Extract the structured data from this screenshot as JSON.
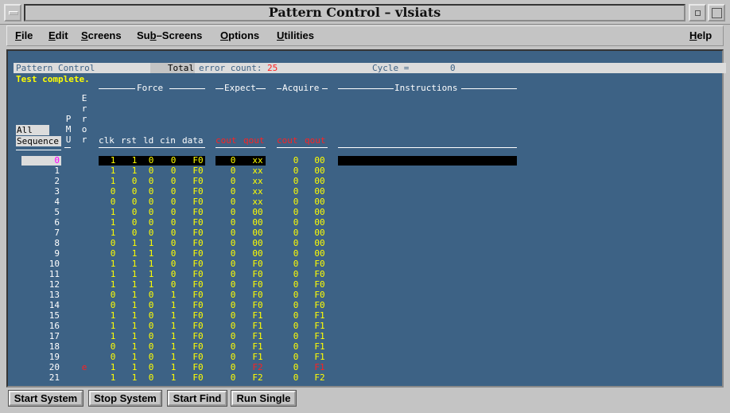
{
  "window": {
    "title": "Pattern Control – vlsiats"
  },
  "menu": {
    "items": [
      {
        "label": "File",
        "u": "F",
        "rest": "ile"
      },
      {
        "label": "Edit",
        "u": "E",
        "rest": "dit"
      },
      {
        "label": "Screens",
        "u": "S",
        "rest": "creens"
      },
      {
        "label": "Sub–Screens",
        "pre": "Su",
        "u": "b",
        "rest": "–Screens"
      },
      {
        "label": "Options",
        "u": "O",
        "rest": "ptions"
      },
      {
        "label": "Utilities",
        "u": "U",
        "rest": "tilities"
      }
    ],
    "help": {
      "u": "H",
      "rest": "elp"
    }
  },
  "info": {
    "panel_label": "Pattern Control",
    "total_label": "Total",
    "error_label": "error count:",
    "error_count": "25",
    "cycle_label": "Cycle =",
    "cycle_value": "0",
    "status": "Test complete."
  },
  "headers": {
    "force": "Force",
    "expect": "Expect",
    "acquire": "Acquire",
    "instructions": "Instructions",
    "pmu": [
      "P",
      "M",
      "U"
    ],
    "error": [
      "E",
      "r",
      "r",
      "o",
      "r"
    ],
    "all_button": "All",
    "sequence_button": "Sequence",
    "force_cols": [
      "clk",
      "rst",
      "ld",
      "cin",
      "data"
    ],
    "expect_cols": [
      "cout",
      "qout"
    ],
    "acquire_cols": [
      "cout",
      "qout"
    ]
  },
  "colors": {
    "panel": "#3d6285",
    "yellow": "#ffff00",
    "red": "#ff2020",
    "white": "#ffffff"
  },
  "rows": [
    {
      "n": "0",
      "err": "",
      "clk": "1",
      "rst": "1",
      "ld": "0",
      "cin": "0",
      "data": "F0",
      "ecout": "0",
      "eqout": "xx",
      "acout": "0",
      "aqout": "00"
    },
    {
      "n": "1",
      "err": "",
      "clk": "1",
      "rst": "1",
      "ld": "0",
      "cin": "0",
      "data": "F0",
      "ecout": "0",
      "eqout": "xx",
      "acout": "0",
      "aqout": "00"
    },
    {
      "n": "2",
      "err": "",
      "clk": "1",
      "rst": "0",
      "ld": "0",
      "cin": "0",
      "data": "F0",
      "ecout": "0",
      "eqout": "xx",
      "acout": "0",
      "aqout": "00"
    },
    {
      "n": "3",
      "err": "",
      "clk": "0",
      "rst": "0",
      "ld": "0",
      "cin": "0",
      "data": "F0",
      "ecout": "0",
      "eqout": "xx",
      "acout": "0",
      "aqout": "00"
    },
    {
      "n": "4",
      "err": "",
      "clk": "0",
      "rst": "0",
      "ld": "0",
      "cin": "0",
      "data": "F0",
      "ecout": "0",
      "eqout": "xx",
      "acout": "0",
      "aqout": "00"
    },
    {
      "n": "5",
      "err": "",
      "clk": "1",
      "rst": "0",
      "ld": "0",
      "cin": "0",
      "data": "F0",
      "ecout": "0",
      "eqout": "00",
      "acout": "0",
      "aqout": "00"
    },
    {
      "n": "6",
      "err": "",
      "clk": "1",
      "rst": "0",
      "ld": "0",
      "cin": "0",
      "data": "F0",
      "ecout": "0",
      "eqout": "00",
      "acout": "0",
      "aqout": "00"
    },
    {
      "n": "7",
      "err": "",
      "clk": "1",
      "rst": "0",
      "ld": "0",
      "cin": "0",
      "data": "F0",
      "ecout": "0",
      "eqout": "00",
      "acout": "0",
      "aqout": "00"
    },
    {
      "n": "8",
      "err": "",
      "clk": "0",
      "rst": "1",
      "ld": "1",
      "cin": "0",
      "data": "F0",
      "ecout": "0",
      "eqout": "00",
      "acout": "0",
      "aqout": "00"
    },
    {
      "n": "9",
      "err": "",
      "clk": "0",
      "rst": "1",
      "ld": "1",
      "cin": "0",
      "data": "F0",
      "ecout": "0",
      "eqout": "00",
      "acout": "0",
      "aqout": "00"
    },
    {
      "n": "10",
      "err": "",
      "clk": "1",
      "rst": "1",
      "ld": "1",
      "cin": "0",
      "data": "F0",
      "ecout": "0",
      "eqout": "F0",
      "acout": "0",
      "aqout": "F0"
    },
    {
      "n": "11",
      "err": "",
      "clk": "1",
      "rst": "1",
      "ld": "1",
      "cin": "0",
      "data": "F0",
      "ecout": "0",
      "eqout": "F0",
      "acout": "0",
      "aqout": "F0"
    },
    {
      "n": "12",
      "err": "",
      "clk": "1",
      "rst": "1",
      "ld": "1",
      "cin": "0",
      "data": "F0",
      "ecout": "0",
      "eqout": "F0",
      "acout": "0",
      "aqout": "F0"
    },
    {
      "n": "13",
      "err": "",
      "clk": "0",
      "rst": "1",
      "ld": "0",
      "cin": "1",
      "data": "F0",
      "ecout": "0",
      "eqout": "F0",
      "acout": "0",
      "aqout": "F0"
    },
    {
      "n": "14",
      "err": "",
      "clk": "0",
      "rst": "1",
      "ld": "0",
      "cin": "1",
      "data": "F0",
      "ecout": "0",
      "eqout": "F0",
      "acout": "0",
      "aqout": "F0"
    },
    {
      "n": "15",
      "err": "",
      "clk": "1",
      "rst": "1",
      "ld": "0",
      "cin": "1",
      "data": "F0",
      "ecout": "0",
      "eqout": "F1",
      "acout": "0",
      "aqout": "F1"
    },
    {
      "n": "16",
      "err": "",
      "clk": "1",
      "rst": "1",
      "ld": "0",
      "cin": "1",
      "data": "F0",
      "ecout": "0",
      "eqout": "F1",
      "acout": "0",
      "aqout": "F1"
    },
    {
      "n": "17",
      "err": "",
      "clk": "1",
      "rst": "1",
      "ld": "0",
      "cin": "1",
      "data": "F0",
      "ecout": "0",
      "eqout": "F1",
      "acout": "0",
      "aqout": "F1"
    },
    {
      "n": "18",
      "err": "",
      "clk": "0",
      "rst": "1",
      "ld": "0",
      "cin": "1",
      "data": "F0",
      "ecout": "0",
      "eqout": "F1",
      "acout": "0",
      "aqout": "F1"
    },
    {
      "n": "19",
      "err": "",
      "clk": "0",
      "rst": "1",
      "ld": "0",
      "cin": "1",
      "data": "F0",
      "ecout": "0",
      "eqout": "F1",
      "acout": "0",
      "aqout": "F1"
    },
    {
      "n": "20",
      "err": "e",
      "clk": "1",
      "rst": "1",
      "ld": "0",
      "cin": "1",
      "data": "F0",
      "ecout": "0",
      "eqout": "F2",
      "acout": "0",
      "aqout": "F1",
      "mismatch": true
    },
    {
      "n": "21",
      "err": "",
      "clk": "1",
      "rst": "1",
      "ld": "0",
      "cin": "1",
      "data": "F0",
      "ecout": "0",
      "eqout": "F2",
      "acout": "0",
      "aqout": "F2"
    }
  ],
  "buttons": {
    "start_system": "Start System",
    "stop_system": "Stop System",
    "start_find": "Start Find",
    "run_single": "Run Single"
  }
}
